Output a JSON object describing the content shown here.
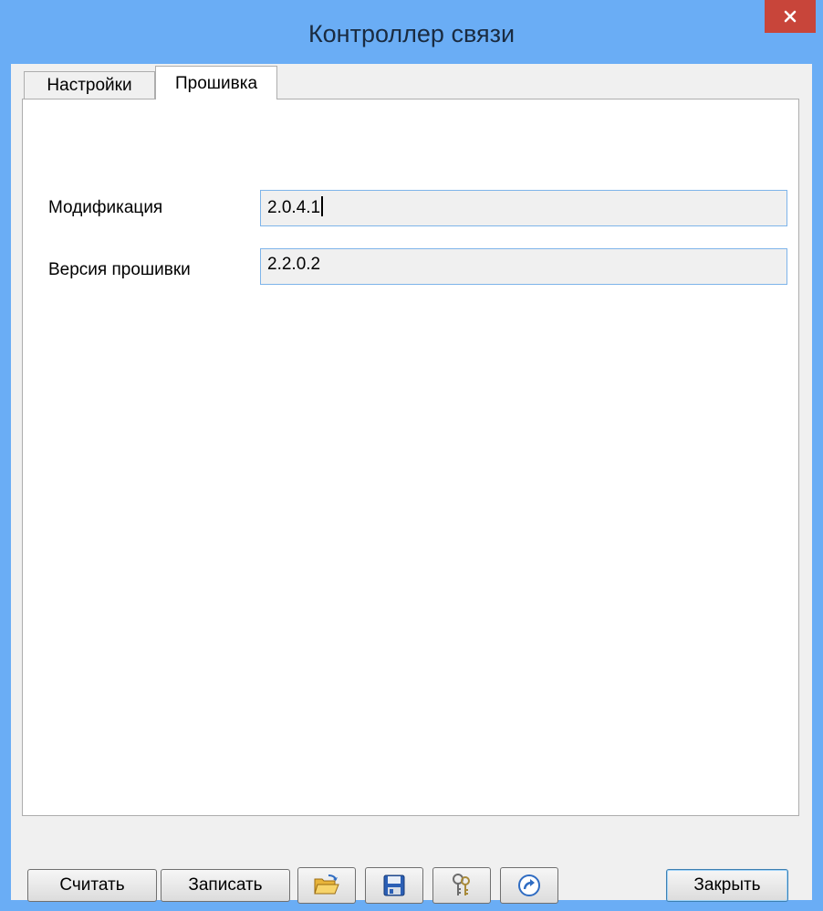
{
  "window": {
    "title": "Контроллер связи"
  },
  "tabs": [
    {
      "label": "Настройки",
      "active": false
    },
    {
      "label": "Прошивка",
      "active": true
    }
  ],
  "fields": {
    "modification": {
      "label": "Модификация",
      "value": "2.0.4.1"
    },
    "firmware_version": {
      "label": "Версия прошивки",
      "value": "2.2.0.2"
    }
  },
  "buttons": {
    "read": "Считать",
    "write": "Записать",
    "open_icon": "folder-open-icon",
    "save_icon": "floppy-save-icon",
    "keys_icon": "keys-icon",
    "forward_icon": "arrow-forward-icon",
    "close": "Закрыть"
  },
  "colors": {
    "titlebar": "#6aadf5",
    "close_button": "#c8453a",
    "input_border": "#7eb4ea"
  }
}
